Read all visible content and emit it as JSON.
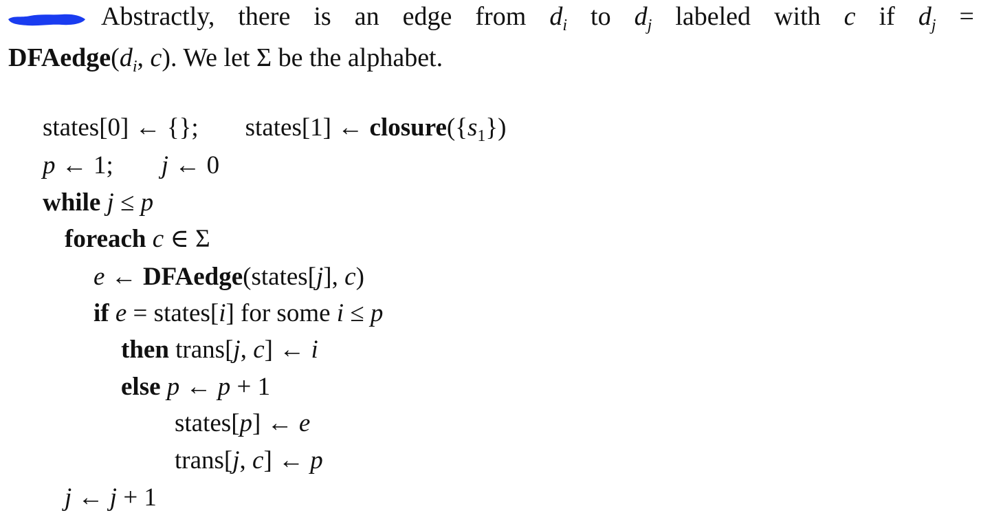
{
  "prose": {
    "line1_words": [
      "Abstractly,",
      "there",
      "is",
      "an",
      "edge",
      "from",
      "d",
      "to",
      "d",
      "labeled",
      "with",
      "c",
      "if",
      "d",
      "="
    ],
    "sub_i": "i",
    "sub_j": "j",
    "line2_bold": "DFAedge",
    "line2_open": "(",
    "line2_d": "d",
    "line2_comma": ", ",
    "line2_c": "c",
    "line2_rest": "). We let Σ be the alphabet."
  },
  "code": {
    "l1_a": "states[0] ← {};",
    "l1_b": "states[1] ← ",
    "l1_bold": "closure",
    "l1_c": "({",
    "l1_s": "s",
    "l1_sub": "1",
    "l1_d": "})",
    "l2_p": "p",
    "l2_a": " ← 1;",
    "l2_j": "j",
    "l2_b": " ← 0",
    "l3_kw": "while",
    "l3_j": "j",
    "l3_le": " ≤ ",
    "l3_p": "p",
    "l4_kw": "foreach",
    "l4_c": "c",
    "l4_rest": " ∈ Σ",
    "l5_e": "e",
    "l5_arrow": " ← ",
    "l5_bold": "DFAedge",
    "l5_a": "(states[",
    "l5_j": "j",
    "l5_b": "], ",
    "l5_c": "c",
    "l5_d": ")",
    "l6_kw": "if",
    "l6_e": "e",
    "l6_a": " = states[",
    "l6_i": "i",
    "l6_b": "] for some ",
    "l6_i2": "i",
    "l6_le": " ≤ ",
    "l6_p": "p",
    "l7_kw": "then",
    "l7_a": " trans[",
    "l7_j": "j",
    "l7_b": ", ",
    "l7_c": "c",
    "l7_d": "] ← ",
    "l7_i": "i",
    "l8_kw": "else",
    "l8_p": "p",
    "l8_arrow": " ← ",
    "l8_p2": "p",
    "l8_rest": " + 1",
    "l9_a": "states[",
    "l9_p": "p",
    "l9_b": "] ← ",
    "l9_e": "e",
    "l10_a": "trans[",
    "l10_j": "j",
    "l10_b": ", ",
    "l10_c": "c",
    "l10_d": "] ← ",
    "l10_p": "p",
    "l11_j": "j",
    "l11_arrow": " ← ",
    "l11_j2": "j",
    "l11_rest": " + 1"
  },
  "colors": {
    "text": "#111111",
    "redaction": "#1a3cf0"
  }
}
